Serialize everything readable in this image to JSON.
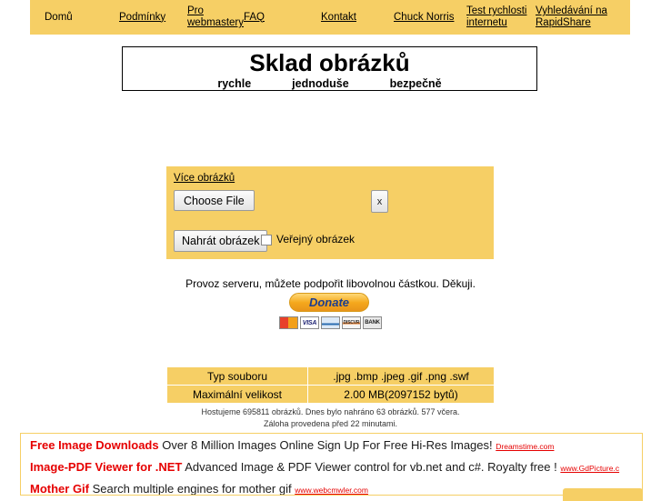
{
  "nav": {
    "items": [
      {
        "label": "Domů",
        "underlined": false
      },
      {
        "label": "Podmínky",
        "underlined": true
      },
      {
        "label": "Pro webmastery",
        "underlined": true
      },
      {
        "label": "FAQ",
        "underlined": true
      },
      {
        "label": "Kontakt",
        "underlined": true
      },
      {
        "label": "Chuck Norris",
        "underlined": true
      },
      {
        "label": "Test rychlosti internetu",
        "underlined": true
      },
      {
        "label": "Vyhledávání na RapidShare",
        "underlined": true
      }
    ]
  },
  "title": {
    "main": "Sklad obrázků",
    "sub1": "rychle",
    "sub2": "jednoduše",
    "sub3": "bezpečně"
  },
  "upload": {
    "more_images_link": "Více obrázků",
    "choose_file_label": "Choose File",
    "remove_row_label": "x",
    "upload_button_label": "Nahrát obrázek",
    "public_checkbox_label": "Veřejný obrázek",
    "public_checked": false
  },
  "donate": {
    "text": "Provoz serveru, můžete podpořit libovolnou částkou. Děkuji.",
    "button_label": "Donate",
    "cards": [
      {
        "name": "mastercard-icon",
        "label": ""
      },
      {
        "name": "visa-icon",
        "label": "VISA"
      },
      {
        "name": "amex-icon",
        "label": ""
      },
      {
        "name": "discover-icon",
        "label": "DISCVR"
      },
      {
        "name": "bank-icon",
        "label": "BANK"
      }
    ]
  },
  "info_table": {
    "rows": [
      {
        "label": "Typ souboru",
        "value": ".jpg .bmp .jpeg .gif .png .swf"
      },
      {
        "label": "Maximální velikost",
        "value": "2.00 MB(2097152 bytů)"
      }
    ]
  },
  "stats": {
    "line1": "Hostujeme 695811 obrázků. Dnes bylo nahráno 63 obrázků. 577 včera.",
    "line2": "Záloha provedena před 22 minutami."
  },
  "ads": {
    "items": [
      {
        "title": "Free Image Downloads",
        "desc": "Over 8 Million Images Online Sign Up For Free Hi-Res Images!",
        "url": "Dreamstime.com"
      },
      {
        "title": "Image-PDF Viewer for .NET",
        "desc": "Advanced Image & PDF Viewer control for vb.net and c#. Royalty free !",
        "url": "www.GdPicture.c"
      },
      {
        "title": "Mother Gif",
        "desc": "Search multiple engines for mother gif",
        "url": "www.webcmwler.com"
      }
    ]
  },
  "colors": {
    "accent_yellow": "#f6cf65",
    "ad_title_red": "#e60000"
  }
}
